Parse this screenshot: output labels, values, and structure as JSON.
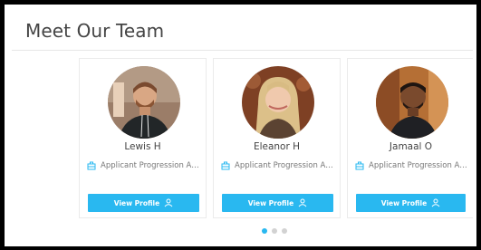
{
  "section": {
    "title": "Meet Our Team"
  },
  "team": [
    {
      "name": "Lewis H",
      "role": "Applicant Progression Advisor",
      "button_label": "View Profile"
    },
    {
      "name": "Eleanor H",
      "role": "Applicant Progression Advisor",
      "button_label": "View Profile"
    },
    {
      "name": "Jamaal O",
      "role": "Applicant Progression Advisor",
      "button_label": "View Profile"
    }
  ],
  "carousel": {
    "dot_count": 3,
    "active_dot": 1
  },
  "colors": {
    "accent": "#29b8f0",
    "title": "#444444",
    "muted": "#777777",
    "dot_inactive": "#d2d2d2"
  },
  "icons": {
    "role": "briefcase-icon",
    "profile": "user-icon"
  }
}
